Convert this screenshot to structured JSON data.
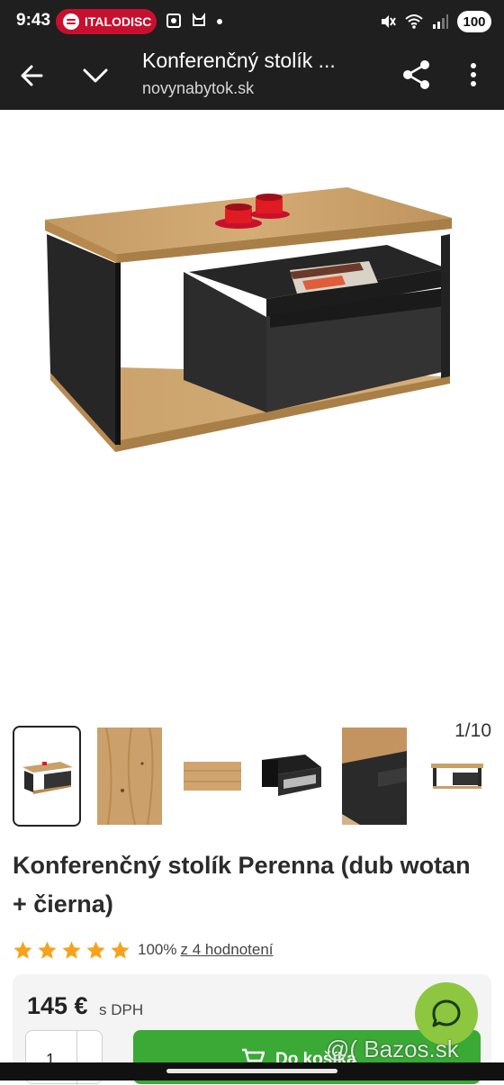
{
  "status_bar": {
    "time": "9:43",
    "media_app": "ITALODISC",
    "battery": "100",
    "pill_color": "#c8102e"
  },
  "toolbar": {
    "title": "Konferenčný stolík ...",
    "url": "novynabytok.sk"
  },
  "gallery": {
    "counter": "1/10",
    "thumbnails": [
      "coffee table",
      "oak wood texture",
      "oak table top",
      "black drawer",
      "table detail",
      "table side view"
    ]
  },
  "product": {
    "title": "Konferenčný stolík Perenna (dub wotan + čierna)",
    "rating_percent": "100%",
    "rating_stars": 5,
    "reviews_link": "z 4 hodnotení",
    "price": "145 €",
    "vat_note": "s DPH",
    "quantity": "1",
    "add_to_cart": "Do košíka"
  },
  "colors": {
    "accent_green": "#3aa935",
    "chat_green": "#8dc63f",
    "star_orange": "#f7a21b"
  },
  "watermark": "@( Bazos.sk"
}
